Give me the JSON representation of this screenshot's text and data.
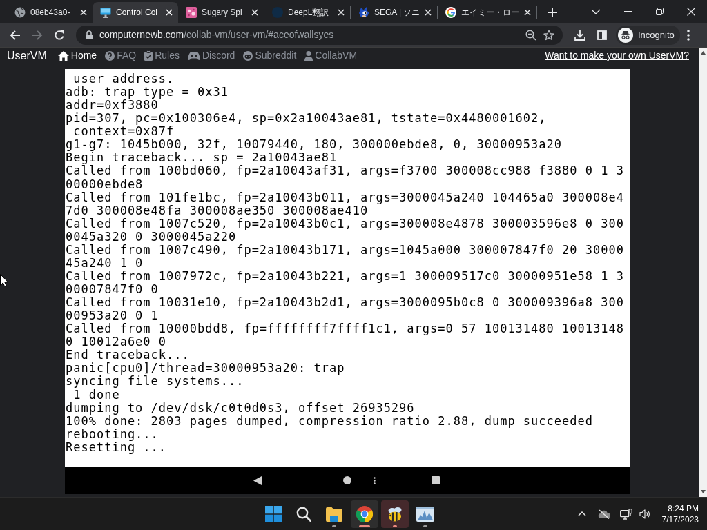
{
  "browser": {
    "tabs": [
      {
        "title": "08eb43a0-",
        "kind": "globe",
        "selected": false
      },
      {
        "title": "Control Col",
        "kind": "monitor",
        "selected": true
      },
      {
        "title": "Sugary Spi",
        "kind": "tile",
        "selected": false
      },
      {
        "title": "DeepL翻訳",
        "kind": "disc",
        "selected": false
      },
      {
        "title": "SEGA | ソニ",
        "kind": "mascot",
        "selected": false
      },
      {
        "title": "エイミー・ロー",
        "kind": "g",
        "selected": false
      }
    ],
    "back_enabled": true,
    "forward_enabled": false,
    "address": {
      "domain": "computernewb.com",
      "path": "/collab-vm/user-vm/#aceofwallsyes"
    },
    "profile": "Incognito"
  },
  "site_nav": {
    "brand": "UserVM",
    "links": [
      {
        "label": "Home",
        "kind": "home",
        "selected": true
      },
      {
        "label": "FAQ",
        "kind": "help",
        "selected": false
      },
      {
        "label": "Rules",
        "kind": "clipboard",
        "selected": false
      },
      {
        "label": "Discord",
        "kind": "gamepad",
        "selected": false
      },
      {
        "label": "Subreddit",
        "kind": "face",
        "selected": false
      },
      {
        "label": "CollabVM",
        "kind": "user",
        "selected": false
      }
    ],
    "cta": "Want to make your own UserVM?"
  },
  "vm_screen": {
    "lines": [
      " user address.",
      "adb: trap type = 0x31",
      "addr=0xf3880",
      "pid=307, pc=0x100306e4, sp=0x2a10043ae81, tstate=0x4480001602,",
      " context=0x87f",
      "g1-g7: 1045b000, 32f, 10079440, 180, 300000ebde8, 0, 30000953a20",
      "Begin traceback... sp = 2a10043ae81",
      "Called from 100bd060, fp=2a10043af31, args=f3700 300008cc988 f3880 0 1 3",
      "00000ebde8",
      "Called from 101fe1bc, fp=2a10043b011, args=3000045a240 104465a0 300008e4",
      "7d0 300008e48fa 300008ae350 300008ae410",
      "Called from 1007c520, fp=2a10043b0c1, args=300008e4878 300003596e8 0 300",
      "0045a320 0 3000045a220",
      "Called from 1007c490, fp=2a10043b171, args=1045a000 300007847f0 20 30000",
      "45a240 1 0",
      "Called from 1007972c, fp=2a10043b221, args=1 300009517c0 30000951e58 1 3",
      "00007847f0 0",
      "Called from 10031e10, fp=2a10043b2d1, args=3000095b0c8 0 300009396a8 300",
      "00953a20 0 1",
      "Called from 10000bdd8, fp=ffffffff7ffff1c1, args=0 57 100131480 10013148",
      "0 10012a6e0 0",
      "End traceback...",
      "panic[cpu0]/thread=30000953a20: trap",
      "syncing file systems...",
      " 1 done",
      "dumping to /dev/dsk/c0t0d0s3, offset 26935296",
      "100% done: 2803 pages dumped, compression ratio 2.88, dump succeeded",
      "rebooting...",
      "Resetting ..."
    ]
  },
  "taskbar": {
    "apps": [
      {
        "kind": "start",
        "running": false,
        "focused": false,
        "flashing": false
      },
      {
        "kind": "search",
        "running": false,
        "focused": false,
        "flashing": false
      },
      {
        "kind": "folder",
        "running": true,
        "focused": false,
        "flashing": false
      },
      {
        "kind": "browser",
        "running": true,
        "focused": true,
        "flashing": false
      },
      {
        "kind": "bee",
        "running": true,
        "focused": false,
        "flashing": true
      },
      {
        "kind": "chart",
        "running": true,
        "focused": false,
        "flashing": false
      }
    ],
    "clock": {
      "time": "8:24 PM",
      "date": "7/17/2023"
    }
  }
}
